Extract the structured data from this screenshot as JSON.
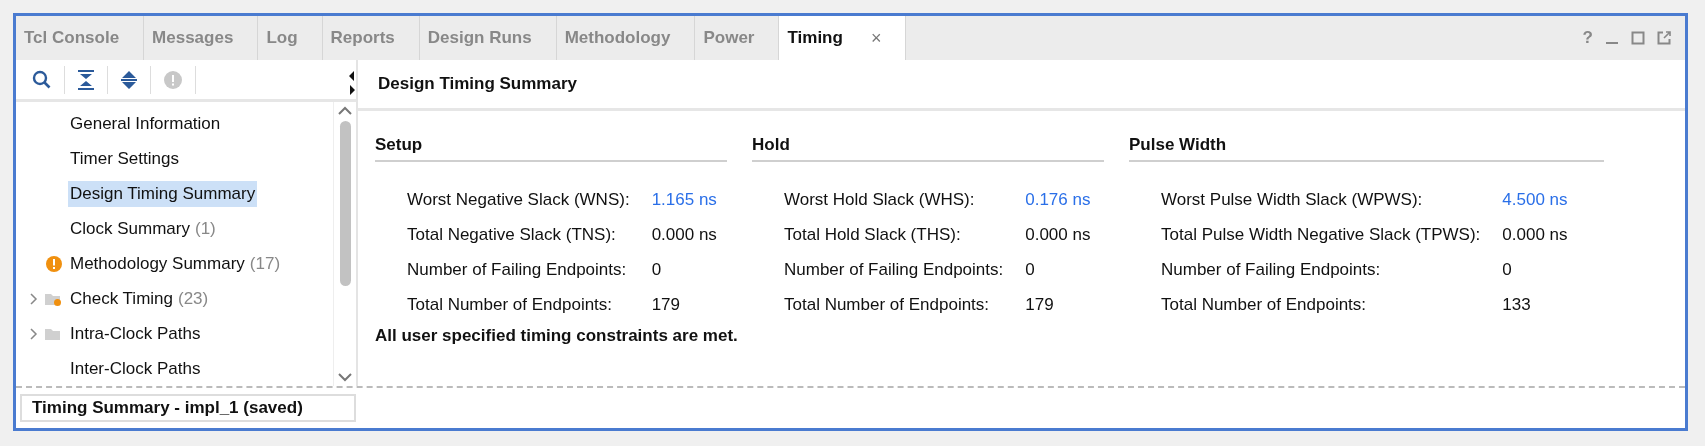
{
  "tabs": [
    {
      "label": "Tcl Console",
      "selected": false
    },
    {
      "label": "Messages",
      "selected": false
    },
    {
      "label": "Log",
      "selected": false
    },
    {
      "label": "Reports",
      "selected": false
    },
    {
      "label": "Design Runs",
      "selected": false
    },
    {
      "label": "Methodology",
      "selected": false
    },
    {
      "label": "Power",
      "selected": false
    },
    {
      "label": "Timing",
      "selected": true,
      "close": "×"
    }
  ],
  "window_controls": {
    "help": "?"
  },
  "panel_title": "Design Timing Summary",
  "tree": [
    {
      "label": "General Information",
      "selected": false,
      "kind": "plain"
    },
    {
      "label": "Timer Settings",
      "selected": false,
      "kind": "plain"
    },
    {
      "label": "Design Timing Summary",
      "selected": true,
      "kind": "plain"
    },
    {
      "label": "Clock Summary",
      "count": "(1)",
      "selected": false,
      "kind": "plain"
    },
    {
      "label": "Methodology Summary",
      "count": "(17)",
      "selected": false,
      "kind": "warning"
    },
    {
      "label": "Check Timing",
      "count": "(23)",
      "selected": false,
      "kind": "folder-flagged",
      "expanded": false
    },
    {
      "label": "Intra-Clock Paths",
      "selected": false,
      "kind": "folder",
      "expanded": false
    },
    {
      "label": "Inter-Clock Paths",
      "selected": false,
      "kind": "plain"
    }
  ],
  "sections": [
    {
      "title": "Setup",
      "rows": [
        {
          "label": "Worst Negative Slack (WNS):",
          "value": "1.165 ns",
          "link": true
        },
        {
          "label": "Total Negative Slack (TNS):",
          "value": "0.000 ns",
          "link": false
        },
        {
          "label": "Number of Failing Endpoints:",
          "value": "0",
          "link": false
        },
        {
          "label": "Total Number of Endpoints:",
          "value": "179",
          "link": false
        }
      ]
    },
    {
      "title": "Hold",
      "rows": [
        {
          "label": "Worst Hold Slack (WHS):",
          "value": "0.176 ns",
          "link": true
        },
        {
          "label": "Total Hold Slack (THS):",
          "value": "0.000 ns",
          "link": false
        },
        {
          "label": "Number of Failing Endpoints:",
          "value": "0",
          "link": false
        },
        {
          "label": "Total Number of Endpoints:",
          "value": "179",
          "link": false
        }
      ]
    },
    {
      "title": "Pulse Width",
      "rows": [
        {
          "label": "Worst Pulse Width Slack (WPWS):",
          "value": "4.500 ns",
          "link": true
        },
        {
          "label": "Total Pulse Width Negative Slack (TPWS):",
          "value": "0.000 ns",
          "link": false
        },
        {
          "label": "Number of Failing Endpoints:",
          "value": "0",
          "link": false
        },
        {
          "label": "Total Number of Endpoints:",
          "value": "133",
          "link": false
        }
      ]
    }
  ],
  "message": "All user specified timing constraints are met.",
  "status_bar": "Timing Summary - impl_1 (saved)"
}
